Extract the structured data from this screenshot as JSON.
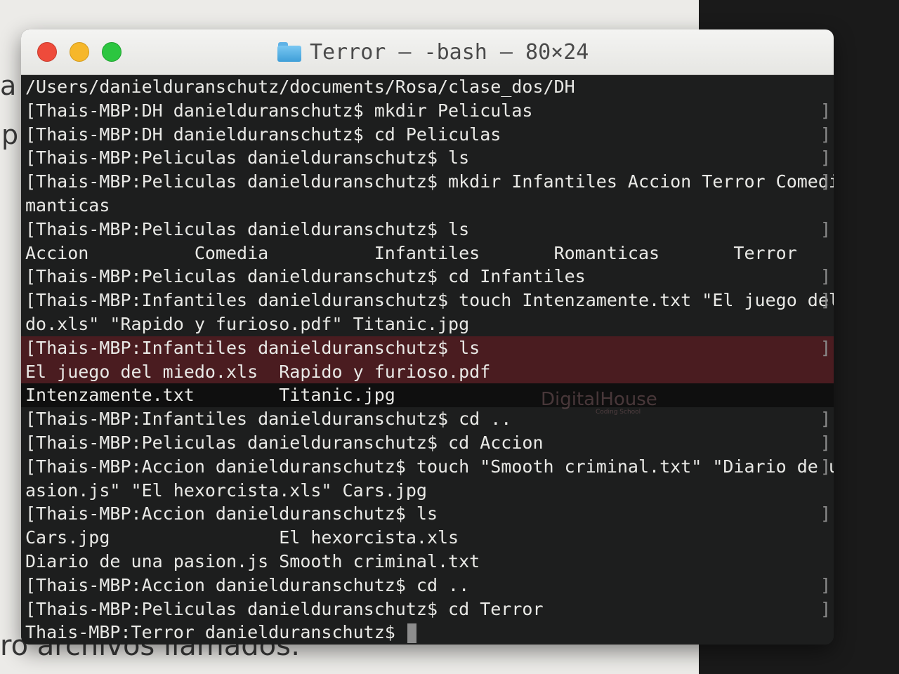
{
  "background": {
    "fragment_1": "a",
    "fragment_2": "p",
    "fragment_3": "ro archivos llamados:"
  },
  "window": {
    "title": "Terror — -bash — 80×24",
    "icons": {
      "close": "close-light",
      "minimize": "minimize-light",
      "zoom": "zoom-light",
      "folder": "folder-icon"
    }
  },
  "terminal": {
    "lines": [
      {
        "text": "/Users/danielduranschutz/documents/Rosa/clase_dos/DH"
      },
      {
        "text": "[Thais-MBP:DH danielduranschutz$ mkdir Peliculas"
      },
      {
        "text": "[Thais-MBP:DH danielduranschutz$ cd Peliculas"
      },
      {
        "text": "[Thais-MBP:Peliculas danielduranschutz$ ls"
      },
      {
        "text": "[Thais-MBP:Peliculas danielduranschutz$ mkdir Infantiles Accion Terror Comedia Ro"
      },
      {
        "text": "manticas"
      },
      {
        "text": "[Thais-MBP:Peliculas danielduranschutz$ ls"
      },
      {
        "text": "Accion          Comedia          Infantiles       Romanticas       Terror"
      },
      {
        "text": "[Thais-MBP:Peliculas danielduranschutz$ cd Infantiles"
      },
      {
        "text": "[Thais-MBP:Infantiles danielduranschutz$ touch Intenzamente.txt \"El juego del mie"
      },
      {
        "text": "do.xls\" \"Rapido y furioso.pdf\" Titanic.jpg"
      },
      {
        "text": "[Thais-MBP:Infantiles danielduranschutz$ ls"
      },
      {
        "text": "El juego del miedo.xls  Rapido y furioso.pdf"
      },
      {
        "text": "Intenzamente.txt        Titanic.jpg"
      },
      {
        "text": "[Thais-MBP:Infantiles danielduranschutz$ cd .."
      },
      {
        "text": "[Thais-MBP:Peliculas danielduranschutz$ cd Accion"
      },
      {
        "text": "[Thais-MBP:Accion danielduranschutz$ touch \"Smooth criminal.txt\" \"Diario de una p"
      },
      {
        "text": "asion.js\" \"El hexorcista.xls\" Cars.jpg"
      },
      {
        "text": "[Thais-MBP:Accion danielduranschutz$ ls"
      },
      {
        "text": "Cars.jpg                El hexorcista.xls"
      },
      {
        "text": "Diario de una pasion.js Smooth criminal.txt"
      },
      {
        "text": "[Thais-MBP:Accion danielduranschutz$ cd .."
      },
      {
        "text": "[Thais-MBP:Peliculas danielduranschutz$ cd Terror"
      },
      {
        "text": "Thais-MBP:Terror danielduranschutz$ "
      }
    ],
    "right_bracket": "]",
    "watermark": "DigitalHouse",
    "watermark_sub": "Coding School"
  },
  "colors": {
    "close": "#ee4b3b",
    "minimize": "#f6b72a",
    "zoom": "#2cc640",
    "terminal_bg": "#1d1e1e",
    "terminal_fg": "#e9e9e6",
    "highlight_red": "#4a1c20"
  }
}
